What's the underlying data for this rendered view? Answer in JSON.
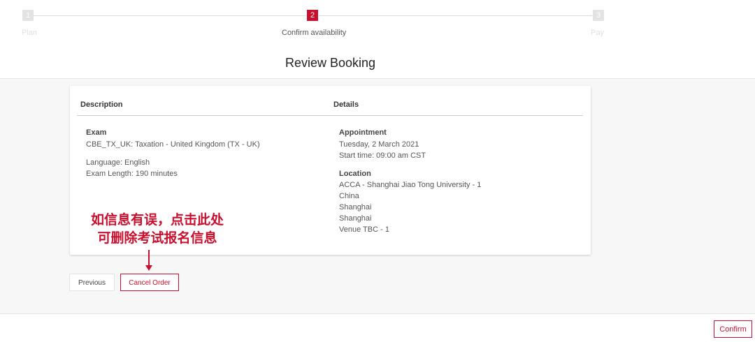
{
  "stepper": {
    "steps": [
      {
        "number": "1",
        "label": "Plan"
      },
      {
        "number": "2",
        "label": "Confirm availability"
      },
      {
        "number": "3",
        "label": "Pay"
      }
    ]
  },
  "page_title": "Review Booking",
  "table": {
    "headers": {
      "description": "Description",
      "details": "Details"
    },
    "exam": {
      "label": "Exam",
      "name": "CBE_TX_UK: Taxation - United Kingdom (TX - UK)",
      "language": "Language: English",
      "length": "Exam Length: 190 minutes"
    },
    "appointment": {
      "label": "Appointment",
      "date": "Tuesday, 2 March 2021",
      "start_time": "Start time: 09:00 am CST"
    },
    "location": {
      "label": "Location",
      "lines": [
        "ACCA - Shanghai Jiao Tong University - 1",
        "China",
        "Shanghai",
        "Shanghai",
        "Venue TBC - 1"
      ]
    }
  },
  "annotation": {
    "line1": "如信息有误，点击此处",
    "line2": "可删除考试报名信息",
    "color": "#c8102e"
  },
  "buttons": {
    "previous": "Previous",
    "cancel_order": "Cancel Order",
    "confirm": "Confirm"
  },
  "colors": {
    "accent": "#c8102e"
  }
}
